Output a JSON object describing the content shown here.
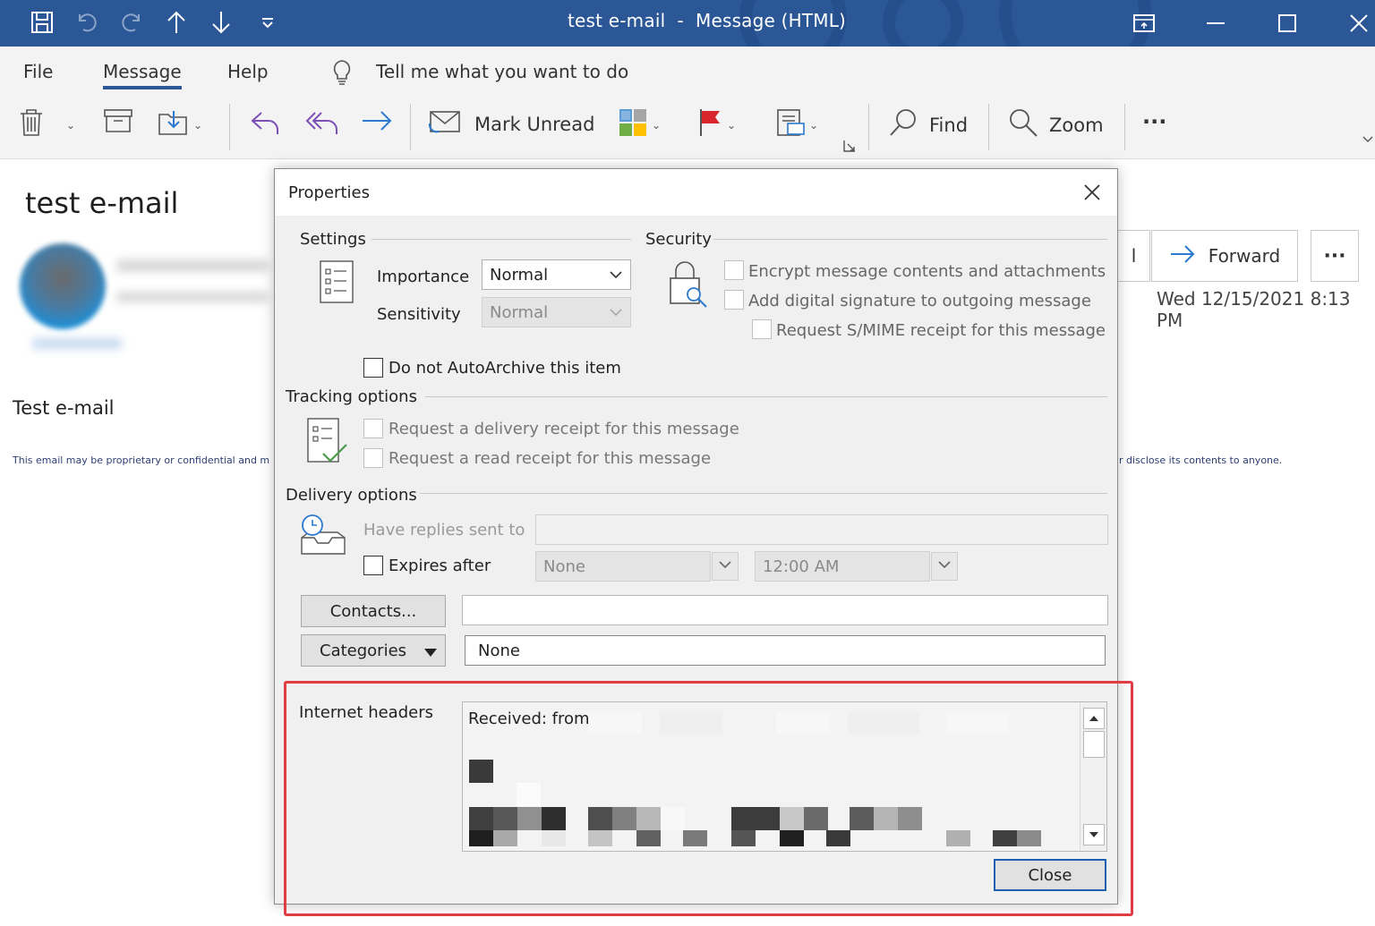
{
  "window": {
    "title": "test e-mail  -  Message (HTML)"
  },
  "menu": {
    "items": [
      "File",
      "Message",
      "Help"
    ],
    "active": "Message",
    "tell_me": "Tell me what you want to do"
  },
  "ribbon": {
    "mark_unread": "Mark Unread",
    "find": "Find",
    "zoom": "Zoom",
    "more": "···"
  },
  "message": {
    "subject": "test e-mail",
    "body": "Test e-mail",
    "disclaimer_left": "This email may be proprietary or confidential and m",
    "disclaimer_right": "r disclose its contents to anyone.",
    "reply_all_partial": "l",
    "forward": "Forward",
    "more": "···",
    "date": "Wed 12/15/2021 8:13 PM"
  },
  "dialog": {
    "title": "Properties",
    "settings": {
      "heading": "Settings",
      "importance_label": "Importance",
      "importance_value": "Normal",
      "sensitivity_label": "Sensitivity",
      "sensitivity_value": "Normal",
      "autoarchive": "Do not AutoArchive this item"
    },
    "security": {
      "heading": "Security",
      "encrypt": "Encrypt message contents and attachments",
      "signature": "Add digital signature to outgoing message",
      "smime": "Request S/MIME receipt for this message"
    },
    "tracking": {
      "heading": "Tracking options",
      "delivery_receipt": "Request a delivery receipt for this message",
      "read_receipt": "Request a read receipt for this message"
    },
    "delivery": {
      "heading": "Delivery options",
      "replies_label": "Have replies sent to",
      "replies_value": "",
      "expires_label": "Expires after",
      "expires_date": "None",
      "expires_time": "12:00 AM"
    },
    "contacts_button": "Contacts...",
    "contacts_value": "",
    "categories_button": "Categories",
    "categories_value": "None",
    "internet_headers_label": "Internet headers",
    "internet_headers_text": "Received: from",
    "close_button": "Close"
  },
  "colors": {
    "titlebar": "#2b5797",
    "highlight": "#e03c44",
    "default_button_border": "#1e5fb4"
  }
}
